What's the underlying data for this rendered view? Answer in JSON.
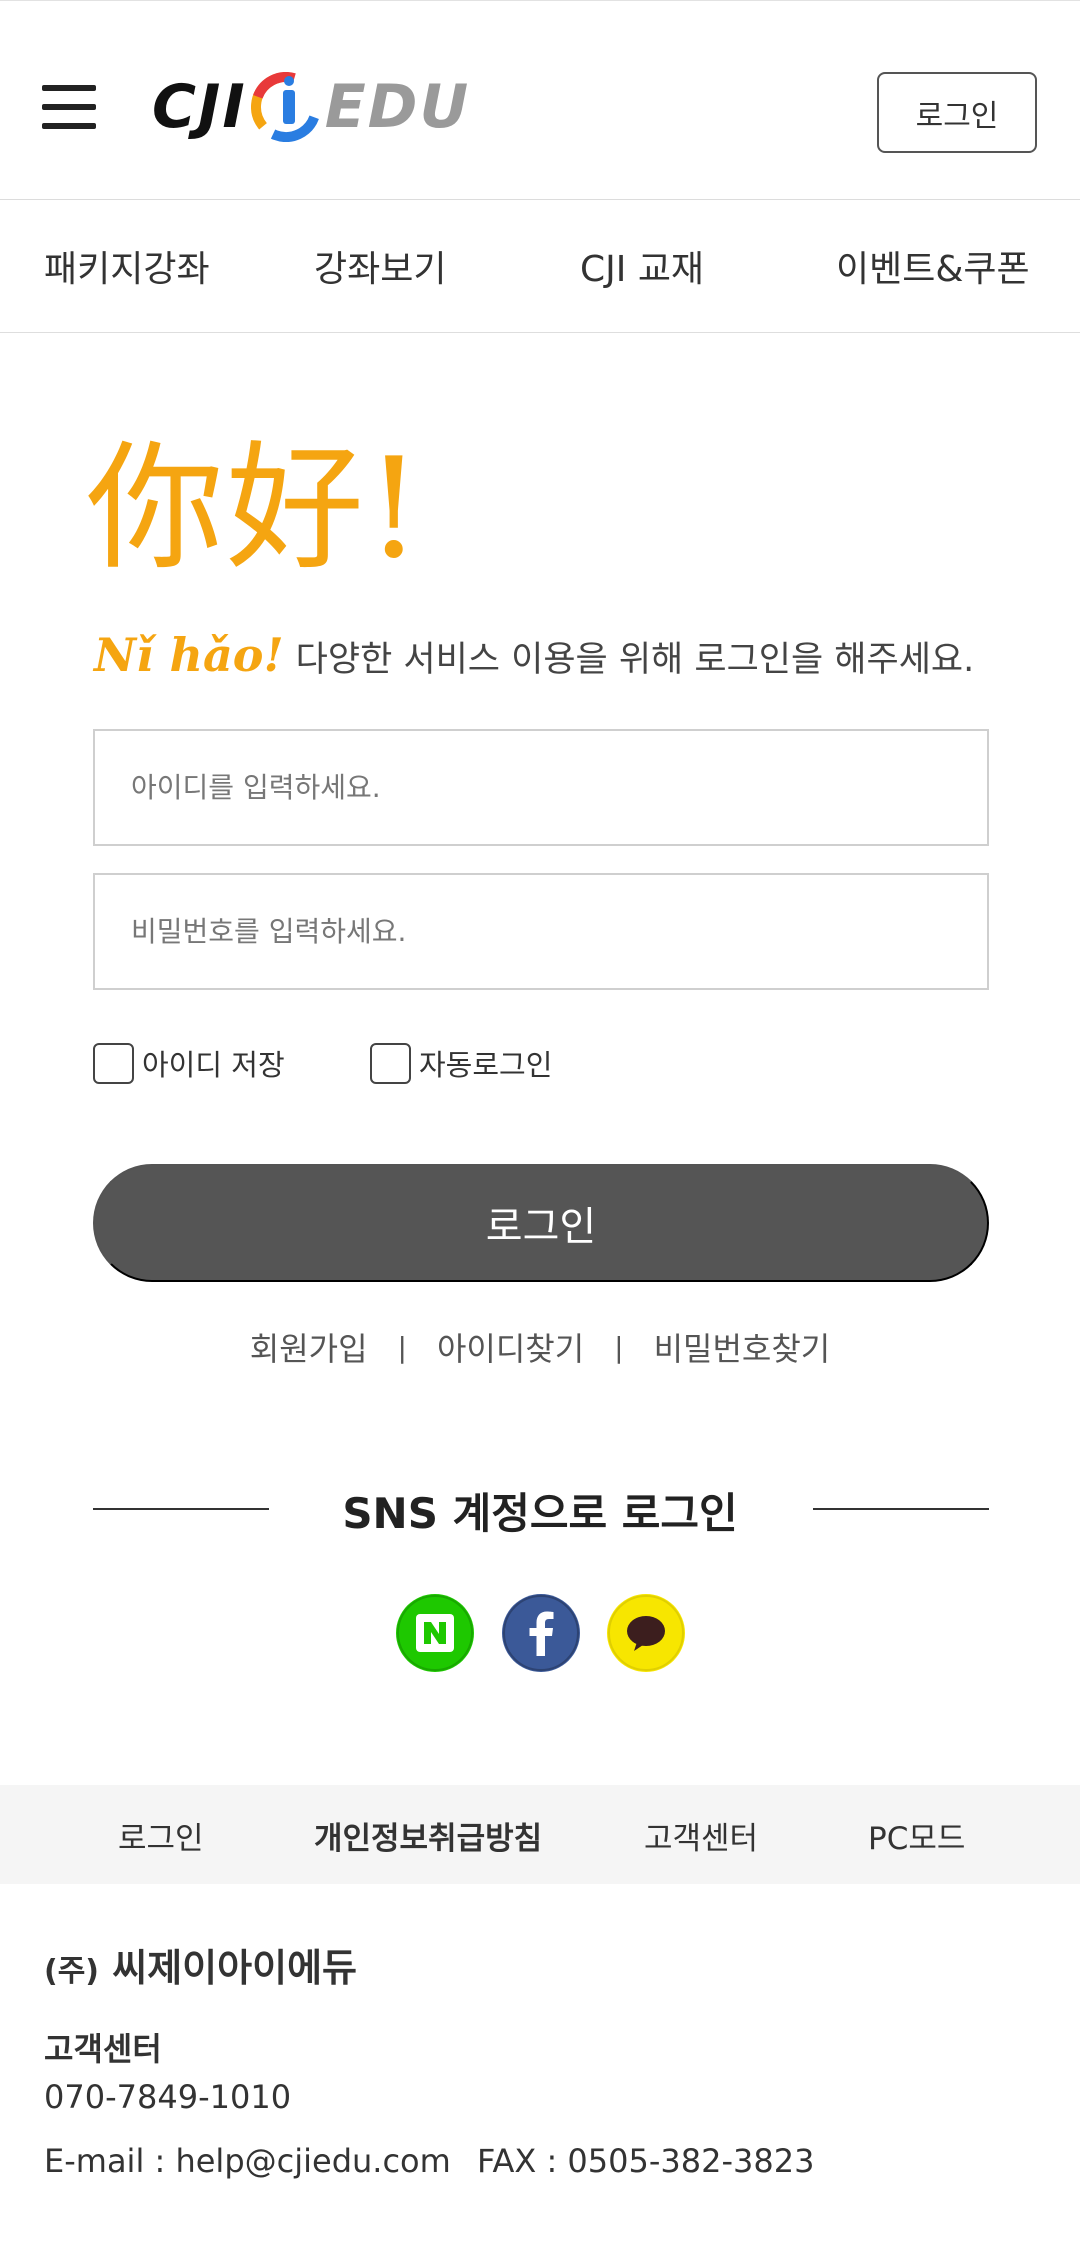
{
  "header": {
    "logo": {
      "left": "CJI",
      "right": "EDU"
    },
    "login_button": "로그인"
  },
  "nav": {
    "items": [
      "패키지강좌",
      "강좌보기",
      "CJI 교재",
      "이벤트&쿠폰"
    ]
  },
  "hero": {
    "chinese": "你好!",
    "pinyin": "Nǐ hǎo!",
    "message": "다양한 서비스 이용을 위해 로그인을 해주세요."
  },
  "form": {
    "id_placeholder": "아이디를 입력하세요.",
    "pw_placeholder": "비밀번호를 입력하세요.",
    "save_id_label": "아이디 저장",
    "auto_login_label": "자동로그인",
    "login_button": "로그인"
  },
  "links": {
    "signup": "회원가입",
    "find_id": "아이디찾기",
    "find_pw": "비밀번호찾기",
    "separator": "|"
  },
  "sns": {
    "title": "SNS 계정으로 로그인",
    "icons": [
      "naver-icon",
      "facebook-icon",
      "kakao-icon"
    ],
    "colors": {
      "naver": "#1ec800",
      "facebook": "#3b5998",
      "kakao": "#f7e600"
    }
  },
  "footer": {
    "links": [
      "로그인",
      "개인정보취급방침",
      "고객센터",
      "PC모드"
    ],
    "company_prefix": "(주)",
    "company_name": "씨제이아이에듀",
    "cs_label": "고객센터",
    "phone": "070-7849-1010",
    "email": "E-mail : help@cjiedu.com",
    "fax": "FAX : 0505-382-3823"
  },
  "colors": {
    "accent": "#f5a511",
    "login_button_bg": "#555555"
  }
}
